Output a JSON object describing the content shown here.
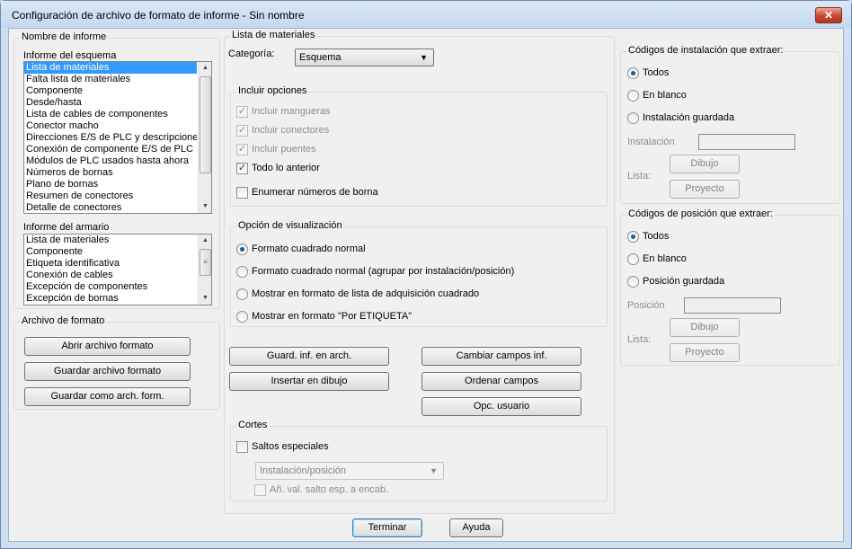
{
  "window": {
    "title": "Configuración de archivo de formato de informe - Sin nombre",
    "close": "✕"
  },
  "report_name": {
    "title": "Nombre de informe",
    "schematic_label": "Informe del esquema",
    "schematic_items": [
      "Lista de materiales",
      "Falta lista de materiales",
      "Componente",
      "Desde/hasta",
      "Lista de cables de componentes",
      "Conector macho",
      "Direcciones E/S de PLC y descripciones",
      "Conexión de componente E/S de PLC",
      "Módulos de PLC usados hasta ahora",
      "Números de bornas",
      "Plano de bornas",
      "Resumen de conectores",
      "Detalle de conectores"
    ],
    "panel_label": "Informe del armario",
    "panel_items": [
      "Lista de materiales",
      "Componente",
      "Etiqueta identificativa",
      "Conexión de cables",
      "Excepción de componentes",
      "Excepción de bornas"
    ]
  },
  "format_file": {
    "title": "Archivo de formato",
    "open": "Abrir archivo formato",
    "save": "Guardar archivo formato",
    "save_as": "Guardar como arch. form."
  },
  "bom": {
    "title": "Lista de materiales",
    "category_label": "Categoría:",
    "category_value": "Esquema",
    "include_title": "Incluir opciones",
    "include_hoses": "Incluir mangueras",
    "include_connectors": "Incluir conectores",
    "include_bridges": "Incluir puentes",
    "all_above": "Todo lo anterior",
    "enumerate_terminals": "Enumerar números de borna",
    "display_title": "Opción de visualización",
    "display_opt1": "Formato cuadrado normal",
    "display_opt2": "Formato cuadrado normal (agrupar por instalación/posición)",
    "display_opt3": "Mostrar en formato de lista de adquisición cuadrado",
    "display_opt4": "Mostrar en formato \"Por ETIQUETA\"",
    "btn_save_report": "Guard. inf. en arch.",
    "btn_insert": "Insertar en dibujo",
    "btn_change_fields": "Cambiar campos inf.",
    "btn_sort": "Ordenar campos",
    "btn_user": "Opc. usuario",
    "breaks_title": "Cortes",
    "special_breaks": "Saltos especiales",
    "breaks_combo": "Instalación/posición",
    "breaks_header": "Añ. val. salto esp. a encab."
  },
  "install_codes": {
    "title": "Códigos de instalación que extraer:",
    "all": "Todos",
    "blank": "En blanco",
    "saved": "Instalación guardada",
    "field_label": "Instalación",
    "list_label": "Lista:",
    "drawing": "Dibujo",
    "project": "Proyecto"
  },
  "location_codes": {
    "title": "Códigos de posición que extraer:",
    "all": "Todos",
    "blank": "En blanco",
    "saved": "Posición guardada",
    "field_label": "Posición",
    "list_label": "Lista:",
    "drawing": "Dibujo",
    "project": "Proyecto"
  },
  "footer": {
    "finish": "Terminar",
    "help": "Ayuda"
  }
}
